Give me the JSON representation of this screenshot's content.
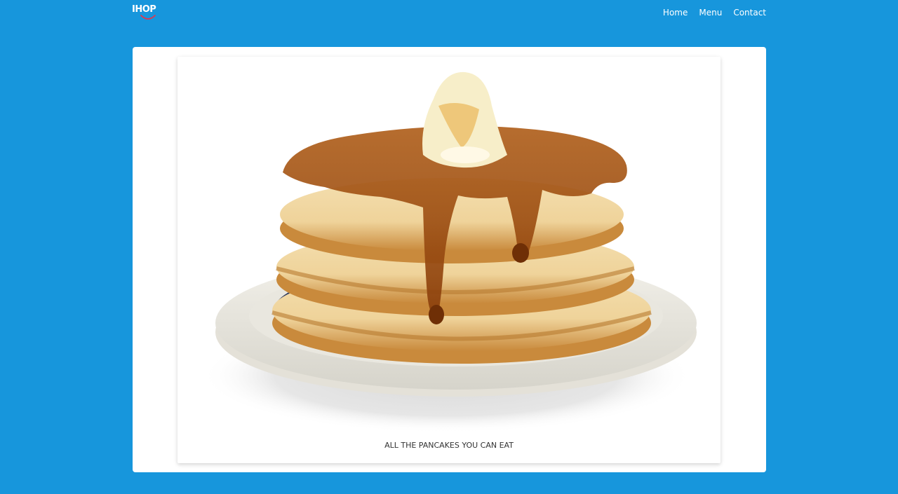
{
  "navbar": {
    "logo_text": "IHOP",
    "logo_icon": "ihop-smile-logo-icon",
    "links": [
      {
        "label": "Home"
      },
      {
        "label": "Menu"
      },
      {
        "label": "Contact"
      }
    ]
  },
  "main": {
    "image_subject": "pancake-stack-photo",
    "caption": "ALL THE PANCAKES YOU CAN EAT"
  },
  "colors": {
    "background": "#1796dc",
    "card": "#ffffff",
    "text": "#333333",
    "logo_smile": "#e8334a"
  }
}
